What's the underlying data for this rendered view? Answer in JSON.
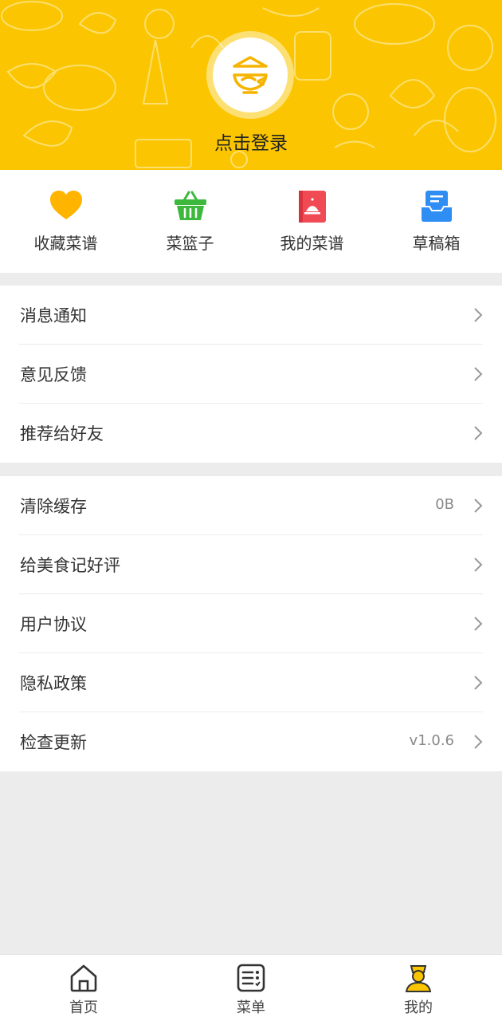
{
  "header": {
    "login_label": "点击登录"
  },
  "quick_actions": [
    {
      "label": "收藏菜谱",
      "icon": "heart-icon",
      "color": "#ffb400"
    },
    {
      "label": "菜篮子",
      "icon": "basket-icon",
      "color": "#3cb93c"
    },
    {
      "label": "我的菜谱",
      "icon": "recipe-book-icon",
      "color": "#f04a55"
    },
    {
      "label": "草稿箱",
      "icon": "draft-box-icon",
      "color": "#2f8ef4"
    }
  ],
  "group1": [
    {
      "label": "消息通知"
    },
    {
      "label": "意见反馈"
    },
    {
      "label": "推荐给好友"
    }
  ],
  "group2": [
    {
      "label": "清除缓存",
      "value": "0B"
    },
    {
      "label": "给美食记好评"
    },
    {
      "label": "用户协议"
    },
    {
      "label": "隐私政策"
    },
    {
      "label": "检查更新",
      "value": "v1.0.6"
    }
  ],
  "tabs": [
    {
      "label": "首页",
      "icon": "home-icon"
    },
    {
      "label": "菜单",
      "icon": "menu-list-icon"
    },
    {
      "label": "我的",
      "icon": "profile-icon",
      "active": true
    }
  ],
  "colors": {
    "brand": "#fbc601",
    "active_tab": "#fbc601"
  }
}
